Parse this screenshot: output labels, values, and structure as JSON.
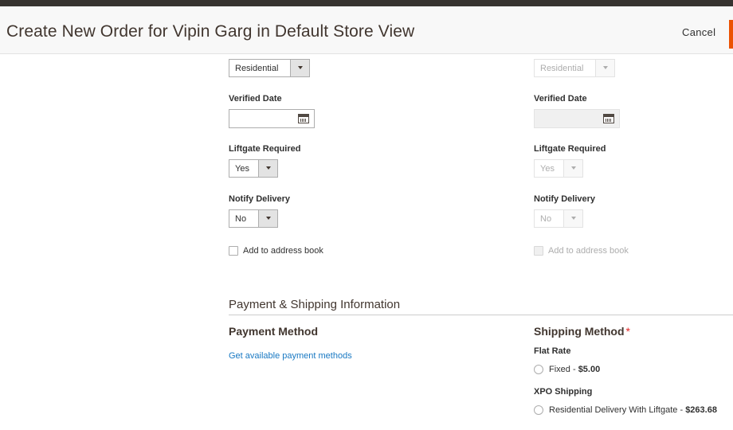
{
  "header": {
    "title": "Create New Order for Vipin Garg in Default Store View",
    "cancel_label": "Cancel"
  },
  "billing": {
    "address_type": "Residential",
    "verified_date_label": "Verified Date",
    "verified_date_value": "",
    "liftgate_label": "Liftgate Required",
    "liftgate_value": "Yes",
    "notify_label": "Notify Delivery",
    "notify_value": "No",
    "add_to_book_label": "Add to address book"
  },
  "shipping": {
    "address_type": "Residential",
    "verified_date_label": "Verified Date",
    "verified_date_value": "",
    "liftgate_label": "Liftgate Required",
    "liftgate_value": "Yes",
    "notify_label": "Notify Delivery",
    "notify_value": "No",
    "add_to_book_label": "Add to address book"
  },
  "payment_shipping": {
    "section_title": "Payment & Shipping Information",
    "payment_method_title": "Payment Method",
    "get_payment_link": "Get available payment methods",
    "shipping_method_title": "Shipping Method",
    "required_marker": "*",
    "carriers": [
      {
        "name": "Flat Rate",
        "rate_label": "Fixed",
        "separator": " - ",
        "price": "$5.00"
      },
      {
        "name": "XPO Shipping",
        "rate_label": "Residential Delivery With Liftgate",
        "separator": " - ",
        "price": "$263.68"
      }
    ]
  },
  "colors": {
    "accent": "#eb5202",
    "link": "#1979c3",
    "required": "#e22626"
  },
  "icons": [
    "calendar-icon",
    "chevron-down-icon"
  ]
}
